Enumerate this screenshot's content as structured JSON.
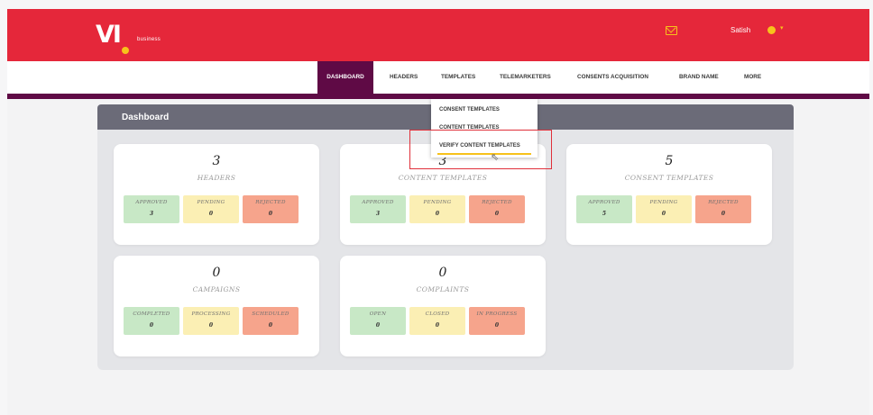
{
  "brand": {
    "logo_text": "VI",
    "logo_sub": "business"
  },
  "header": {
    "user_name": "Satish",
    "mail_icon": "mail-icon",
    "user_icon": "user-icon",
    "caret": "▾"
  },
  "nav": {
    "items": [
      {
        "label": "DASHBOARD",
        "active": true
      },
      {
        "label": "HEADERS"
      },
      {
        "label": "TEMPLATES"
      },
      {
        "label": "TELEMARKETERS"
      },
      {
        "label": "CONSENTS ACQUISITION"
      },
      {
        "label": "BRAND NAME"
      },
      {
        "label": "MORE"
      }
    ]
  },
  "dropdown": {
    "items": [
      {
        "label": "CONSENT TEMPLATES"
      },
      {
        "label": "CONTENT TEMPLATES"
      },
      {
        "label": "VERIFY CONTENT TEMPLATES"
      }
    ]
  },
  "panel": {
    "title": "Dashboard"
  },
  "cards": [
    {
      "count": "3",
      "label": "HEADERS",
      "stats": [
        {
          "label": "APPROVED",
          "value": "3"
        },
        {
          "label": "PENDING",
          "value": "0"
        },
        {
          "label": "REJECTED",
          "value": "0"
        }
      ]
    },
    {
      "count": "3",
      "label": "CONTENT TEMPLATES",
      "stats": [
        {
          "label": "APPROVED",
          "value": "3"
        },
        {
          "label": "PENDING",
          "value": "0"
        },
        {
          "label": "REJECTED",
          "value": "0"
        }
      ]
    },
    {
      "count": "5",
      "label": "CONSENT TEMPLATES",
      "stats": [
        {
          "label": "APPROVED",
          "value": "5"
        },
        {
          "label": "PENDING",
          "value": "0"
        },
        {
          "label": "REJECTED",
          "value": "0"
        }
      ]
    },
    {
      "count": "0",
      "label": "CAMPAIGNS",
      "stats": [
        {
          "label": "COMPLETED",
          "value": "0"
        },
        {
          "label": "PROCESSING",
          "value": "0"
        },
        {
          "label": "SCHEDULED",
          "value": "0"
        }
      ]
    },
    {
      "count": "0",
      "label": "COMPLAINTS",
      "stats": [
        {
          "label": "OPEN",
          "value": "0"
        },
        {
          "label": "CLOSED",
          "value": "0"
        },
        {
          "label": "IN PROGRESS",
          "value": "0"
        }
      ]
    }
  ],
  "colors": {
    "brand_red": "#e5273a",
    "nav_active": "#5f0a45",
    "accent_yellow": "#f7c21b",
    "approved": "#c8e8c6",
    "pending": "#fbefb4",
    "rejected": "#f6a48c"
  }
}
